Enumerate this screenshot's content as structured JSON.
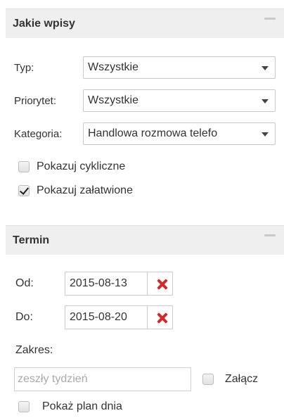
{
  "section_entries": {
    "title": "Jakie wpisy",
    "type": {
      "label": "Typ:",
      "value": "Wszystkie"
    },
    "priority": {
      "label": "Priorytet:",
      "value": "Wszystkie"
    },
    "category": {
      "label": "Kategoria:",
      "value": "Handlowa rozmowa telefo"
    },
    "show_recurring": {
      "label": "Pokazuj cykliczne",
      "checked": false
    },
    "show_done": {
      "label": "Pokazuj załatwione",
      "checked": true
    }
  },
  "section_term": {
    "title": "Termin",
    "from": {
      "label": "Od:",
      "value": "2015-08-13"
    },
    "to": {
      "label": "Do:",
      "value": "2015-08-20"
    },
    "range_label": "Zakres:",
    "range_placeholder": "zeszły tydzień",
    "attach": {
      "label": "Załącz",
      "checked": false
    },
    "show_day_plan": {
      "label": "Pokaż plan dnia",
      "checked": false
    }
  },
  "icons": {
    "collapse": "minus-icon",
    "dropdown": "chevron-down-icon",
    "clear": "red-x-icon"
  },
  "colors": {
    "header_bg": "#efefef",
    "clear_icon": "#d42a2a"
  }
}
